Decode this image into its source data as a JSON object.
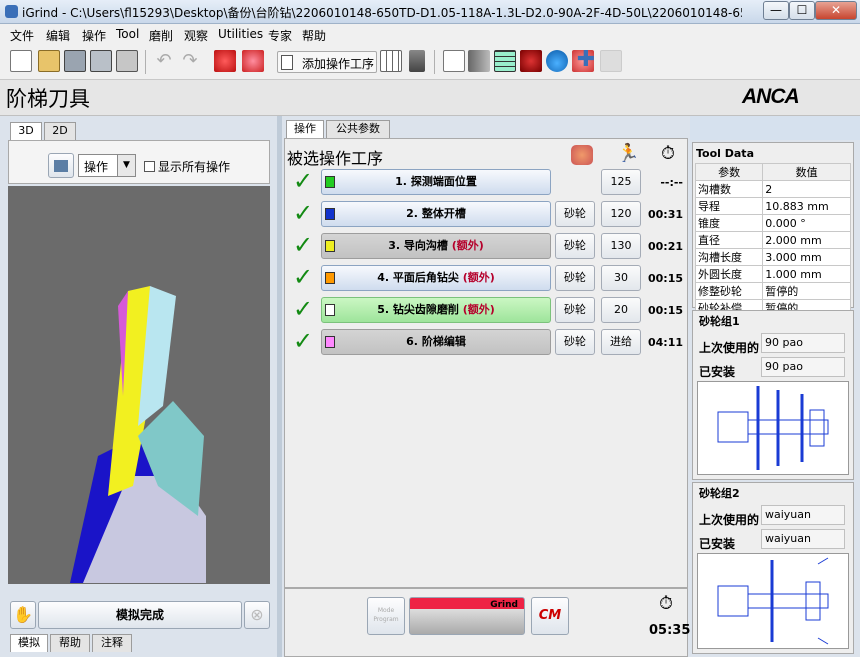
{
  "window": {
    "title": "iGrind - C:\\Users\\fl15293\\Desktop\\备份\\台阶钻\\2206010148-650TD-D1.05-118A-1.3L-D2.0-90A-2F-4D-50L\\2206010148-650TD-D1.05-118A-...",
    "minimize": "—",
    "maximize": "☐",
    "close": "✕"
  },
  "menu": [
    "文件",
    "编辑",
    "操作",
    "Tool",
    "磨削",
    "观察",
    "Utilities",
    "专家",
    "帮助"
  ],
  "toolbar": {
    "add_operation_label": "添加操作工序"
  },
  "page": {
    "title": "阶梯刀具",
    "logo": "ANCA"
  },
  "left_panel": {
    "tabs": [
      "3D",
      "2D"
    ],
    "op_select": "操作",
    "show_all_label": "显示所有操作",
    "simulate_button": "模拟完成",
    "bottom_tabs": [
      "模拟",
      "帮助",
      "注释"
    ]
  },
  "center_panel": {
    "tabs": [
      "操作",
      "公共参数"
    ],
    "section_title": "被选操作工序",
    "operations": [
      {
        "num": "1.",
        "name": "探测端面位置",
        "extra": "",
        "color": "#22cc22",
        "style": "normal",
        "wheel": "",
        "value": "125",
        "time": "--:--"
      },
      {
        "num": "2.",
        "name": "整体开槽",
        "extra": "",
        "color": "#1133cc",
        "style": "normal",
        "wheel": "砂轮4...",
        "value": "120",
        "time": "00:31"
      },
      {
        "num": "3.",
        "name": "导向沟槽",
        "extra": " (额外)",
        "color": "#eeee22",
        "style": "gray",
        "wheel": "砂轮4...",
        "value": "130",
        "time": "00:21"
      },
      {
        "num": "4.",
        "name": "平面后角钻尖",
        "extra": " (额外)",
        "color": "#ff9900",
        "style": "normal",
        "wheel": "砂轮1...",
        "value": "30",
        "time": "00:15"
      },
      {
        "num": "5.",
        "name": "钻尖齿隙磨削",
        "extra": " (额外)",
        "color": "#ffffff",
        "style": "green",
        "wheel": "砂轮3...",
        "value": "20",
        "time": "00:15"
      },
      {
        "num": "6.",
        "name": "阶梯编辑",
        "extra": "",
        "color": "#ff88ff",
        "style": "gray",
        "wheel": "砂轮",
        "value": "进给",
        "time": "04:11"
      }
    ],
    "footer": {
      "mode_label": "Mode Program",
      "grind_label": "Grind",
      "total_time": "05:35"
    }
  },
  "right_panel": {
    "tool_data_title": "Tool Data",
    "table_headers": [
      "参数",
      "数值"
    ],
    "rows": [
      [
        "沟槽数",
        "2"
      ],
      [
        "导程",
        "10.883 mm"
      ],
      [
        "锥度",
        "0.000 °"
      ],
      [
        "直径",
        "2.000 mm"
      ],
      [
        "沟槽长度",
        "3.000 mm"
      ],
      [
        "外圆长度",
        "1.000 mm"
      ],
      [
        "修整砂轮",
        "暂停的"
      ],
      [
        "砂轮补偿.",
        "暂停的"
      ]
    ],
    "wheel_group1": {
      "title": "砂轮组1",
      "last_used_label": "上次使用的",
      "last_used": "90 pao",
      "installed_label": "已安装",
      "installed": "90 pao"
    },
    "wheel_group2": {
      "title": "砂轮组2",
      "last_used_label": "上次使用的",
      "last_used": "waiyuan",
      "installed_label": "已安装",
      "installed": "waiyuan"
    }
  }
}
